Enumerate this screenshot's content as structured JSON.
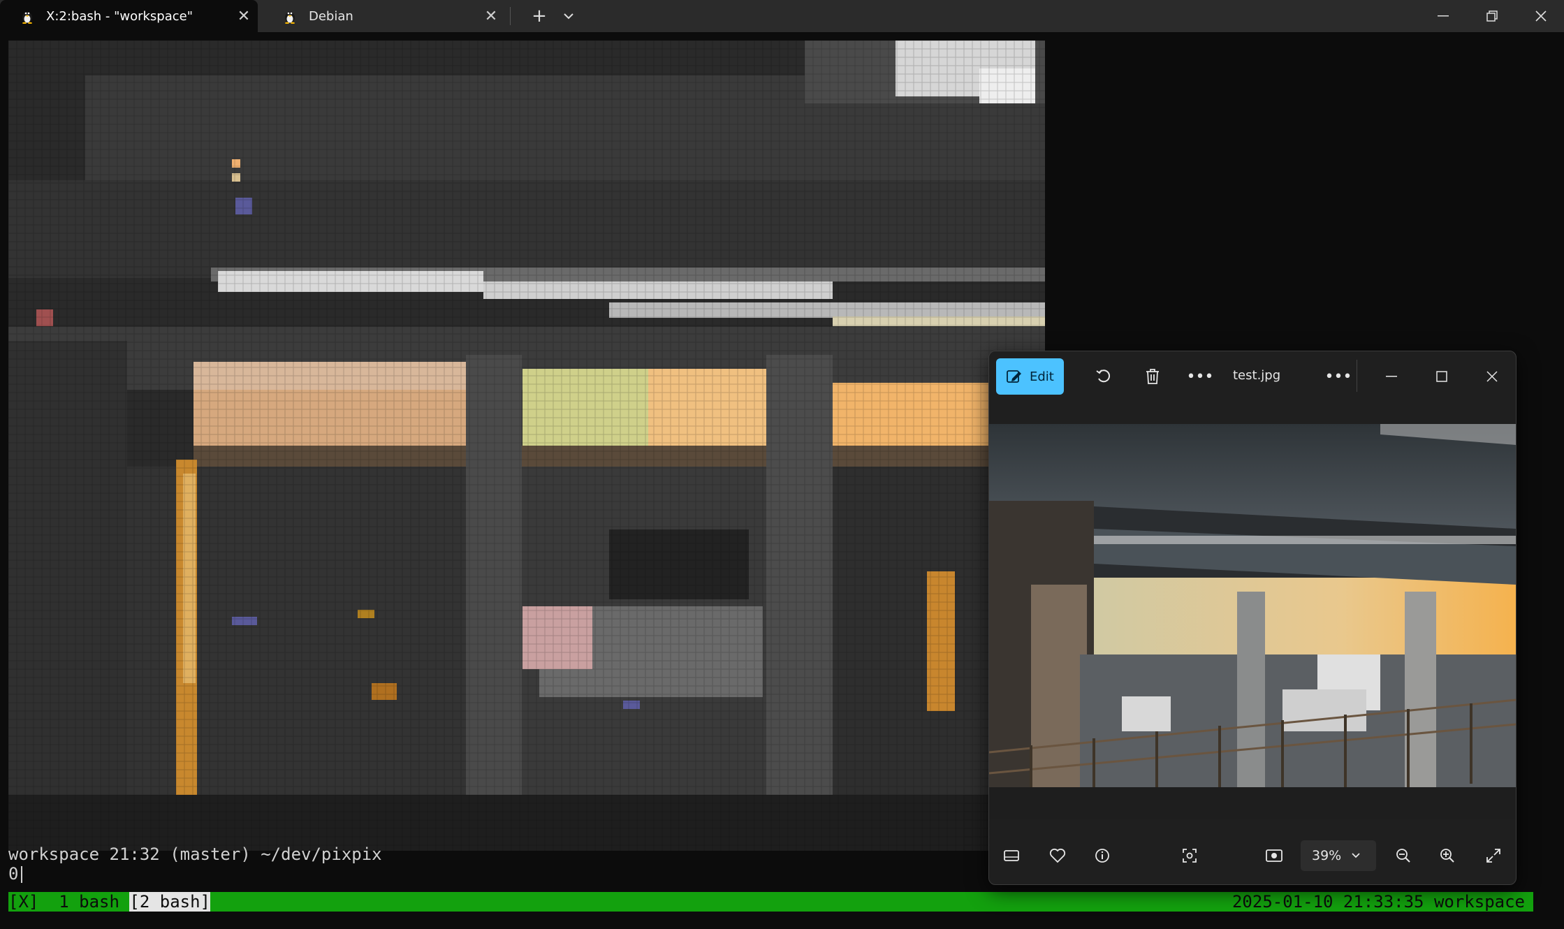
{
  "tabs": [
    {
      "title": "X:2:bash - \"workspace\"",
      "icon": "tux-icon",
      "active": true
    },
    {
      "title": "Debian",
      "icon": "tux-icon",
      "active": false
    }
  ],
  "terminal": {
    "prompt": "workspace 21:32 (master) ~/dev/pixpix",
    "output": "0"
  },
  "tmux": {
    "session_marker": "[X]",
    "window1": " 1 bash ",
    "window2": "[2 bash]",
    "right_status": "2025-01-10 21:33:35 workspace",
    "status_color": "#13a10e"
  },
  "photos": {
    "edit_label": "Edit",
    "filename": "test.jpg",
    "zoom": "39%",
    "accent": "#4cc2ff"
  }
}
